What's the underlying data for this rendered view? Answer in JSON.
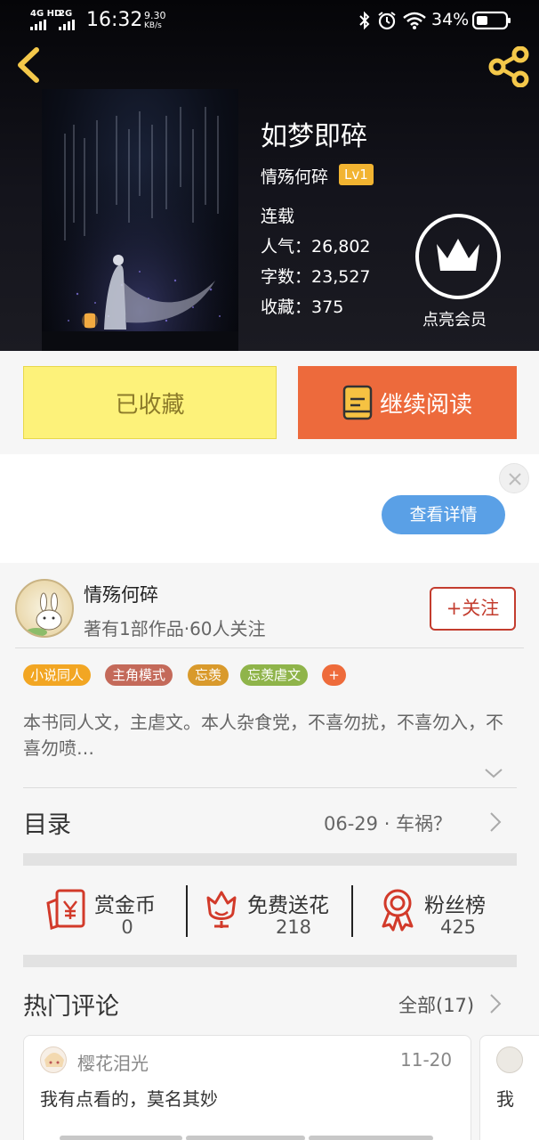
{
  "status_bar": {
    "network1": "4G HD",
    "network2": "2G",
    "time": "16:32",
    "speed_value": "9.30",
    "speed_unit": "KB/s",
    "battery": "34%"
  },
  "book": {
    "title": "如梦即碎",
    "author": "情殇何碎",
    "level": "Lv1",
    "status": "连载",
    "popularity_label": "人气：",
    "popularity": "26,802",
    "word_count_label": "字数：",
    "word_count": "23,527",
    "favorites_label": "收藏：",
    "favorites": "375"
  },
  "member": {
    "label": "点亮会员"
  },
  "actions": {
    "collected_label": "已收藏",
    "continue_label": "继续阅读"
  },
  "ad": {
    "details_label": "查看详情"
  },
  "author_section": {
    "name": "情殇何碎",
    "meta": "著有1部作品·60人关注",
    "follow_label": "+关注"
  },
  "tags": [
    {
      "label": "小说同人",
      "color": "#f2a623"
    },
    {
      "label": "主角模式",
      "color": "#c46a5a"
    },
    {
      "label": "忘羡",
      "color": "#d99a2c"
    },
    {
      "label": "忘羡虐文",
      "color": "#8fb44a"
    },
    {
      "label": "+",
      "color": "#ee6b3b"
    }
  ],
  "summary": "本书同人文，主虐文。本人杂食党，不喜勿扰，不喜勿入，不喜勿喷…",
  "catalog": {
    "label": "目录",
    "latest": "06-29 · 车祸？"
  },
  "stats": [
    {
      "label": "赏金币",
      "value": "0",
      "icon": "red-envelope-yen-icon"
    },
    {
      "label": "免费送花",
      "value": "218",
      "icon": "flower-icon"
    },
    {
      "label": "粉丝榜",
      "value": "425",
      "icon": "medal-icon"
    }
  ],
  "comments": {
    "title": "热门评论",
    "all_label": "全部(17)",
    "items": [
      {
        "user": "樱花泪光",
        "date": "11-20",
        "text": "我有点看的，莫名其妙"
      },
      {
        "user": "",
        "date": "",
        "text": "我"
      }
    ]
  },
  "colors": {
    "collected_bg": "#fdf27a",
    "continue_bg": "#ed6a3c",
    "details_bg": "#5aa0e6",
    "follow_border": "#c33c2e",
    "stat_icon": "#d23a2a",
    "level_bg": "#f2b431"
  }
}
